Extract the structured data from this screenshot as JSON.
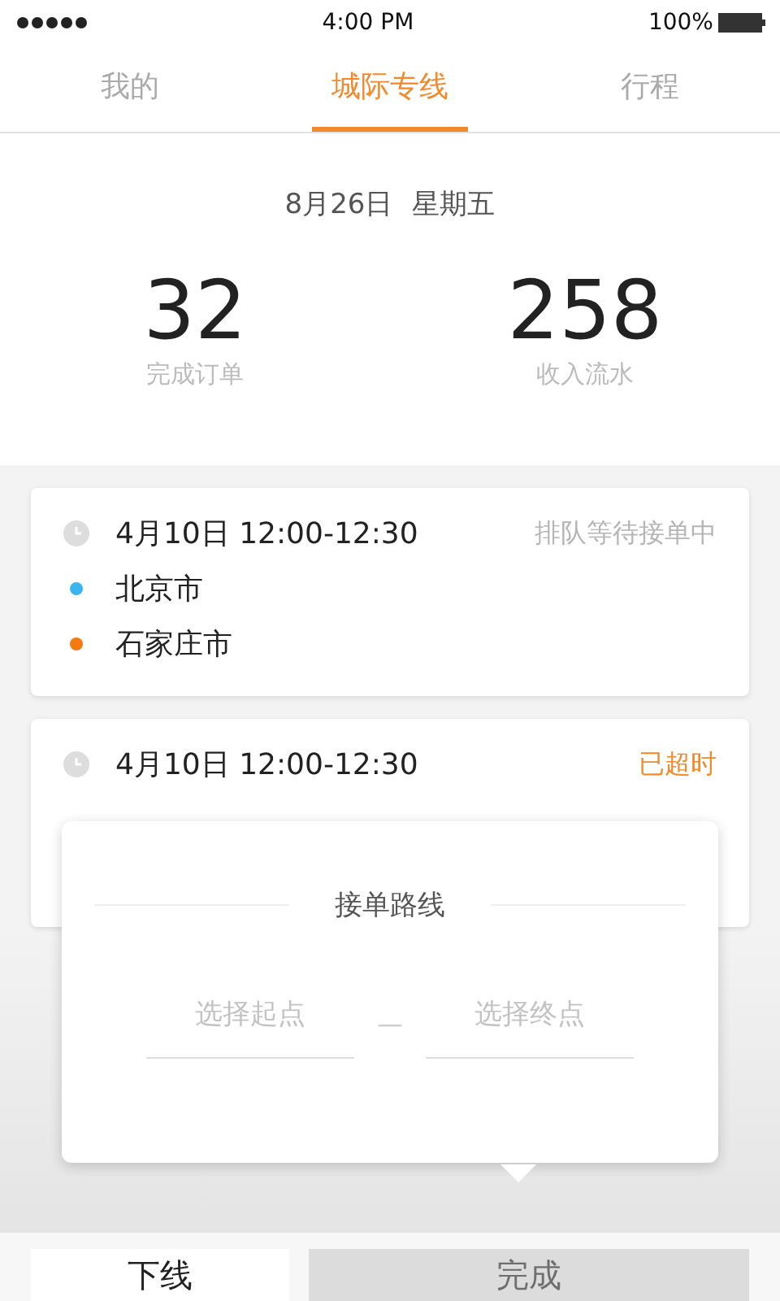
{
  "status_bar": {
    "time": "4:00 PM",
    "battery": "100%"
  },
  "tabs": [
    {
      "label": "我的",
      "selected": false
    },
    {
      "label": "城际专线",
      "selected": true
    },
    {
      "label": "行程",
      "selected": false
    }
  ],
  "summary": {
    "date": "8月26日",
    "weekday": "星期五",
    "stats": [
      {
        "value": "32",
        "label": "完成订单"
      },
      {
        "value": "258",
        "label": "收入流水"
      }
    ]
  },
  "orders": [
    {
      "time": "4月10日 12:00-12:30",
      "status": "排队等待接单中",
      "kind": "waiting",
      "stops": [
        {
          "name": "北京市",
          "color": "#3cb4f0"
        },
        {
          "name": "石家庄市",
          "color": "#f47a12"
        }
      ]
    },
    {
      "time": "4月10日 12:00-12:30",
      "status": "已超时",
      "kind": "overdue"
    }
  ],
  "route_popup": {
    "title": "接单路线",
    "start": {
      "placeholder": "选择起点"
    },
    "separator": "—",
    "end": {
      "placeholder": "选择终点"
    }
  },
  "buttons": [
    {
      "label": "下线",
      "kind": "secondary"
    },
    {
      "label": "完成",
      "kind": "primary"
    }
  ]
}
